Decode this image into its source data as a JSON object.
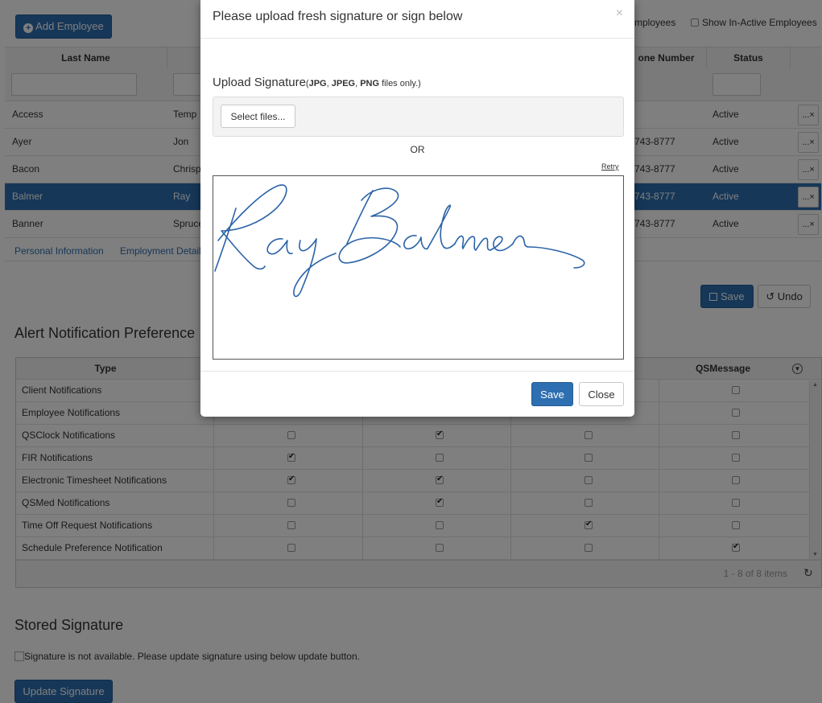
{
  "toolbar": {
    "add_employee_label": "Add Employee",
    "employees_toggle_label": "mployees",
    "show_inactive_label": "Show In-Active Employees"
  },
  "employee_grid": {
    "columns": {
      "last_name": "Last Name",
      "phone": "one Number",
      "status": "Status"
    },
    "rows": [
      {
        "last": "Access",
        "first": "Temp",
        "phone": "",
        "status": "Active"
      },
      {
        "last": "Ayer",
        "first": "Jon",
        "phone": "743-8777",
        "status": "Active"
      },
      {
        "last": "Bacon",
        "first": "Chrisp",
        "phone": "743-8777",
        "status": "Active"
      },
      {
        "last": "Balmer",
        "first": "Ray",
        "phone": "743-8777",
        "status": "Active"
      },
      {
        "last": "Banner",
        "first": "Spruce",
        "phone": "743-8777",
        "status": "Active"
      }
    ],
    "row_button_label": "...×"
  },
  "tabs": {
    "personal": "Personal Information",
    "employment": "Employment Details"
  },
  "actions": {
    "save_label": "Save",
    "undo_label": "Undo"
  },
  "alerts": {
    "title": "Alert Notification Preference",
    "col_type": "Type",
    "col_qsmessage": "QSMessage",
    "rows": [
      {
        "type": "Client Notifications",
        "checks": [
          false,
          false,
          false,
          false
        ]
      },
      {
        "type": "Employee Notifications",
        "checks": [
          false,
          false,
          false,
          false
        ]
      },
      {
        "type": "QSClock Notifications",
        "checks": [
          false,
          true,
          false,
          false
        ]
      },
      {
        "type": "FIR Notifications",
        "checks": [
          true,
          false,
          false,
          false
        ]
      },
      {
        "type": "Electronic Timesheet Notifications",
        "checks": [
          true,
          true,
          false,
          false
        ]
      },
      {
        "type": "QSMed Notifications",
        "checks": [
          false,
          true,
          false,
          false
        ]
      },
      {
        "type": "Time Off Request Notifications",
        "checks": [
          false,
          false,
          true,
          false
        ]
      },
      {
        "type": "Schedule Preference Notification",
        "checks": [
          false,
          false,
          false,
          true
        ]
      }
    ],
    "pager": "1 - 8 of 8 items"
  },
  "stored_signature": {
    "title": "Stored Signature",
    "unavailable": "Signature is not available. Please update signature using below update button.",
    "update_label": "Update Signature"
  },
  "modal": {
    "title": "Please upload fresh signature or sign below",
    "close_x": "×",
    "upload_label": "Upload Signature",
    "upload_fmt_open": "(",
    "fmt_jpg": "JPG",
    "fmt_sep1": ", ",
    "fmt_jpeg": "JPEG",
    "fmt_sep2": ", ",
    "fmt_png": "PNG",
    "fmt_tail": " files only.)",
    "select_files_label": "Select files...",
    "or_label": "OR",
    "retry_label": "Retry",
    "save_label": "Save",
    "close_label": "Close"
  },
  "colors": {
    "primary": "#2d6fb0",
    "selected_row": "#2d6fb0",
    "signature_ink": "#2a63a8"
  }
}
